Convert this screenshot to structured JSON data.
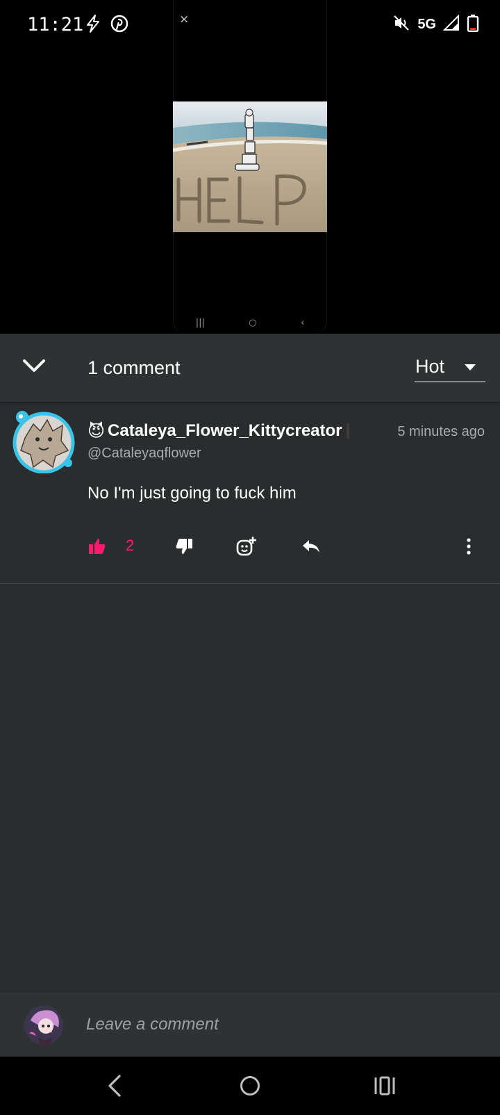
{
  "status_bar": {
    "time": "11:21",
    "network": "5G",
    "icons": [
      "flash-icon",
      "pinterest-icon",
      "mute-icon",
      "signal-icon",
      "battery-low-icon"
    ]
  },
  "media": {
    "close_glyph": "×",
    "image_text": "HELP"
  },
  "comments_header": {
    "count_label": "1 comment",
    "sort_value": "Hot"
  },
  "comment": {
    "author_emoji": "😈",
    "author_name": "Cataleya_Flower_Kittycreator",
    "handle": "@Cataleyaqflower",
    "time": "5 minutes ago",
    "body": "No I'm just going to fuck him",
    "like_count": "2"
  },
  "comment_input": {
    "placeholder": "Leave a comment"
  },
  "colors": {
    "accent_pink": "#ff1a70",
    "background": "#2a2d2e",
    "header_bg": "#2f3233",
    "avatar_ring": "#3cc2e6"
  }
}
